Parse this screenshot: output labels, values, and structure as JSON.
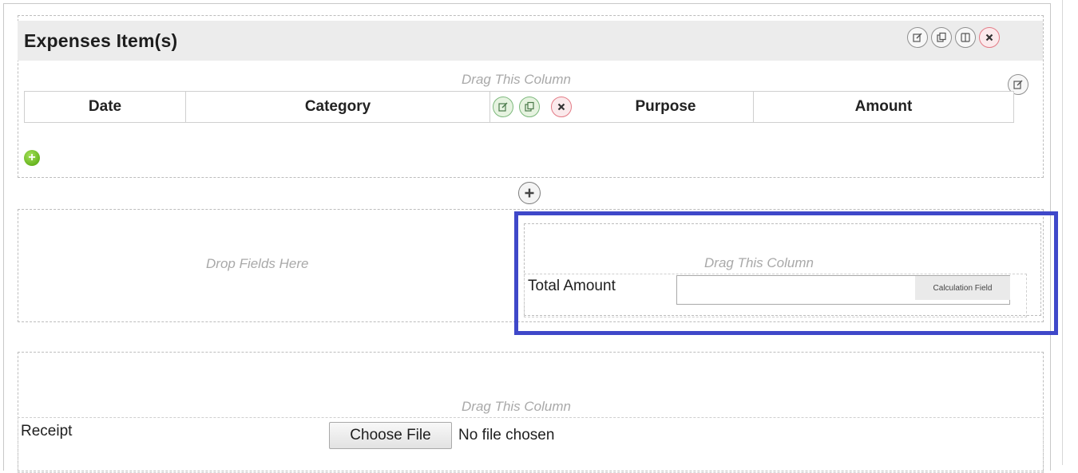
{
  "section": {
    "title": "Expenses Item(s)",
    "actions": [
      "edit-icon",
      "copy-icon",
      "columns-icon",
      "close-icon"
    ]
  },
  "table": {
    "drag_label": "Drag This Column",
    "columns": [
      "Date",
      "Category",
      "Purpose",
      "Amount"
    ],
    "column_actions": [
      "edit-icon",
      "copy-icon",
      "close-icon"
    ]
  },
  "row2": {
    "left_label": "Drop Fields Here",
    "right_drag_label": "Drag This Column",
    "field_label": "Total Amount",
    "field_value": "",
    "field_type_badge": "Calculation Field"
  },
  "row3": {
    "drag_label": "Drag This Column",
    "field_label": "Receipt",
    "file_button": "Choose File",
    "file_status": "No file chosen"
  },
  "colors": {
    "highlight": "#3f48c9",
    "header_bg": "#ececec",
    "add_green": "#68b520",
    "danger": "#e37b86"
  }
}
